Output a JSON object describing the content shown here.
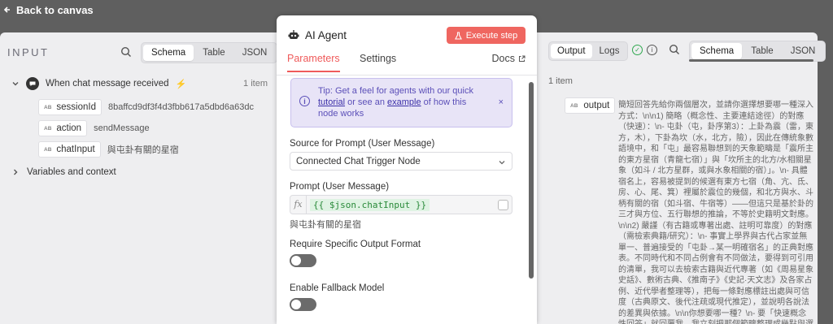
{
  "topbar": {
    "back_label": "Back to canvas"
  },
  "input": {
    "title": "INPUT",
    "view_tabs": [
      "Schema",
      "Table",
      "JSON"
    ],
    "active_tab": "Schema",
    "node": {
      "label": "When chat message received",
      "count": "1 item"
    },
    "fields": [
      {
        "name": "sessionId",
        "value": "8baffcd9df3f4d3fbb617a5dbd6a63dc"
      },
      {
        "name": "action",
        "value": "sendMessage"
      },
      {
        "name": "chatInput",
        "value": "與屯卦有關的星宿"
      }
    ],
    "variables_label": "Variables and context"
  },
  "node_panel": {
    "title": "AI Agent",
    "execute_label": "Execute step",
    "tabs": [
      "Parameters",
      "Settings"
    ],
    "active_tab": "Parameters",
    "docs_label": "Docs",
    "tip": {
      "prefix": "Tip: Get a feel for agents with our quick",
      "link1": "tutorial",
      "middle": "or see an",
      "link2": "example",
      "suffix": "of how this node works"
    },
    "prompt_source_label": "Source for Prompt (User Message)",
    "prompt_source_value": "Connected Chat Trigger Node",
    "prompt_label": "Prompt (User Message)",
    "prompt_expression": "{{ $json.chatInput }}",
    "prompt_result": "與屯卦有關的星宿",
    "require_output_label": "Require Specific Output Format",
    "require_output_on": false,
    "fallback_label": "Enable Fallback Model",
    "fallback_on": false
  },
  "output": {
    "tabs": [
      "Output",
      "Logs"
    ],
    "active_tab": "Output",
    "view_tabs": [
      "Schema",
      "Table",
      "JSON"
    ],
    "active_view": "Schema",
    "items_count": "1 item",
    "key": "output",
    "text": "簡短回答先給你兩個層次，並請你選擇想要哪一種深入方式：\\n\\n1) 簡略（概念性、主要連結途徑）的對應（快速）：\\n- 屯卦（屯，卦序第3）：上卦為震（雷，東方，木），下卦為坎（水，北方，險），因此在傳統象數語境中，和「屯」最容易聯想到的天象範疇是「震所主的東方星宿（青龍七宿）」與「坎所主的北方/水相關星象（如斗 / 北方星群，或與水象相關的宿）」。\\n- 具體宿名上，容易被提到的候選有東方七宿（角、亢、氐、房、心、尾、箕）裡屬於震位的幾個，和北方與水、斗柄有關的宿（如斗宿、牛宿等）——但這只是基於卦的三才與方位、五行聯想的推論，不等於史籍明文對應。\\n\\n2) 嚴謹（有古籍或專著出處、註明可靠度）的對應（需檢索典籍/研究）：\\n- 事實上學界與古代占家並無單一、普遍接受的「屯卦→某一明確宿名」的正典對應表。不同時代和不同占例會有不同做法，要得到可引用的清單，我可以去檢索古籍與近代專著（如《周易星象史話》、數術古典、《推南子》《史記·天文志》及各家占例、近代學者整理等），把每一條對應標註出處與可信度（古典原文、後代注疏或現代推定），並說明各說法的差異與依據。\\n\\n你想要哪一種？\\n- 要「快速概念性回答」就回覆我，我立刻把那個範疇整理成幾點與選宿名與解釋。\\n- 要「嚴謹、有來源的清單」請回覆要我幫你檢索典籍 / 專著，並告訴我你偏好（A）只看古代原典、（B）只看近代/現代學術整理，或（C）兩..."
  },
  "colors": {
    "accent": "#ef5a5a",
    "tip_bg": "#e8e4f7",
    "ok": "#2fa84f"
  },
  "icons": [
    "back-arrow-icon",
    "search-icon",
    "chevron-down-icon",
    "chat-icon",
    "bolt-icon",
    "chevron-right-icon",
    "robot-icon",
    "flask-icon",
    "external-link-icon",
    "info-icon",
    "close-icon",
    "expand-icon",
    "check-circle-icon"
  ]
}
